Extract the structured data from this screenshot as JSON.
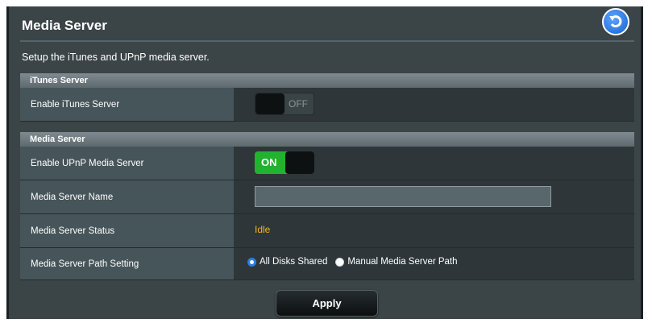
{
  "page": {
    "title": "Media Server",
    "description": "Setup the iTunes and UPnP media server.",
    "back_icon": "back-arrow-icon"
  },
  "itunes_section": {
    "header": "iTunes Server",
    "enable_label": "Enable iTunes Server",
    "toggle_state": "OFF"
  },
  "media_section": {
    "header": "Media Server",
    "enable_label": "Enable UPnP Media Server",
    "toggle_state": "ON",
    "name_label": "Media Server Name",
    "name_value": "",
    "status_label": "Media Server Status",
    "status_value": "Idle",
    "path_label": "Media Server Path Setting",
    "path_options": [
      "All Disks Shared",
      "Manual Media Server Path"
    ],
    "path_selected": "All Disks Shared"
  },
  "actions": {
    "apply_label": "Apply"
  },
  "colors": {
    "accent_on": "#21b32e",
    "status_text": "#f3b21b",
    "back_button": "#1763cf"
  }
}
